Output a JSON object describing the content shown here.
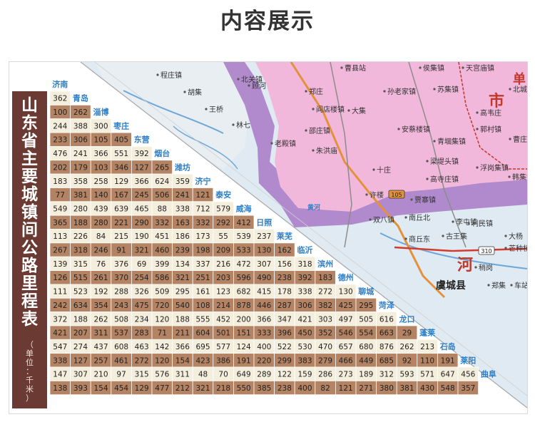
{
  "page_title": "内容展示",
  "table_title": "山东省主要城镇间公路里程表",
  "table_unit": "（单位：千米）",
  "colors": {
    "cream": "#f4eedd",
    "brown": "#b38363",
    "title_bg": "#6b3a33",
    "city_text": "#2d7fc8",
    "map_bg": "#dfeaf3",
    "province_pink": "#f2b8dc",
    "province_purple": "#a879c6"
  },
  "cities": [
    "济南",
    "青岛",
    "淄博",
    "枣庄",
    "东营",
    "烟台",
    "潍坊",
    "济宁",
    "泰安",
    "威海",
    "日照",
    "莱芜",
    "临沂",
    "滨州",
    "德州",
    "聊城",
    "菏泽",
    "龙口",
    "蓬莱",
    "石岛",
    "莱阳",
    "曲阜"
  ],
  "distances": [
    [
      362
    ],
    [
      100,
      262
    ],
    [
      244,
      388,
      300
    ],
    [
      233,
      306,
      105,
      405
    ],
    [
      476,
      241,
      366,
      551,
      392
    ],
    [
      202,
      179,
      103,
      346,
      127,
      265
    ],
    [
      183,
      358,
      258,
      129,
      366,
      624,
      359
    ],
    [
      77,
      381,
      140,
      167,
      245,
      506,
      241,
      121
    ],
    [
      549,
      280,
      439,
      639,
      465,
      88,
      338,
      712,
      579
    ],
    [
      365,
      188,
      280,
      221,
      290,
      332,
      163,
      332,
      292,
      412
    ],
    [
      113,
      226,
      84,
      215,
      190,
      451,
      186,
      173,
      55,
      539,
      237
    ],
    [
      267,
      318,
      246,
      91,
      321,
      460,
      239,
      198,
      209,
      533,
      130,
      162
    ],
    [
      139,
      315,
      76,
      376,
      69,
      399,
      134,
      337,
      216,
      472,
      307,
      156,
      318
    ],
    [
      126,
      515,
      261,
      370,
      254,
      586,
      321,
      251,
      203,
      596,
      490,
      238,
      392,
      183
    ],
    [
      111,
      523,
      192,
      288,
      326,
      509,
      295,
      161,
      123,
      682,
      415,
      178,
      338,
      272,
      130
    ],
    [
      242,
      634,
      354,
      243,
      475,
      720,
      540,
      108,
      214,
      878,
      446,
      287,
      306,
      382,
      425,
      295
    ],
    [
      372,
      188,
      262,
      508,
      234,
      120,
      188,
      555,
      452,
      200,
      366,
      347,
      421,
      303,
      497,
      505,
      616
    ],
    [
      421,
      207,
      311,
      537,
      283,
      71,
      211,
      604,
      501,
      151,
      333,
      396,
      450,
      352,
      546,
      554,
      663,
      29
    ],
    [
      547,
      274,
      437,
      608,
      463,
      142,
      366,
      695,
      577,
      124,
      400,
      522,
      530,
      470,
      657,
      680,
      876,
      262,
      213
    ],
    [
      338,
      127,
      257,
      461,
      272,
      120,
      154,
      423,
      386,
      191,
      220,
      299,
      383,
      279,
      466,
      449,
      685,
      92,
      110,
      191
    ],
    [
      147,
      307,
      210,
      97,
      315,
      576,
      311,
      48,
      70,
      649,
      289,
      122,
      159,
      286,
      273,
      189,
      312,
      593,
      571,
      647,
      456
    ],
    [
      138,
      393,
      154,
      454,
      129,
      477,
      212,
      321,
      218,
      550,
      385,
      238,
      400,
      82,
      121,
      271,
      380,
      381,
      430,
      548,
      357
    ]
  ],
  "map_labels": {
    "towns": [
      "程庄镇",
      "北关镇",
      "胡集",
      "王桥",
      "林七",
      "顾河",
      "老殿镇",
      "郑庄",
      "曹县站",
      "孙老家镇",
      "侯集镇",
      "天宫庙镇",
      "苏集镇",
      "北城",
      "大集",
      "阎店楼镇",
      "安蔡楼镇",
      "高韦庄",
      "郭村镇",
      "邵庄镇",
      "青堌集镇",
      "曹庄",
      "朱洪庙",
      "浮岗集镇",
      "韩集镇",
      "高寺庄镇",
      "十庄",
      "梁堤头镇",
      "许楼",
      "贾寨镇",
      "双八镇",
      "古王集",
      "李屯镇",
      "利民镇",
      "芒种桥",
      "南丘北",
      "商丘东",
      "稍岗",
      "郑集",
      "车站",
      "大杨"
    ],
    "big_labels": [
      "市",
      "单",
      "河",
      "黄河",
      "虞城县"
    ],
    "roads": [
      "105",
      "310"
    ]
  }
}
